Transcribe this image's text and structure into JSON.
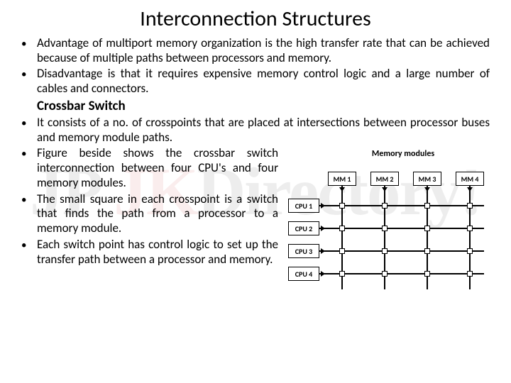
{
  "title": "Interconnection Structures",
  "bullets": {
    "b1": "Advantage of multiport memory organization is the high transfer rate that can be achieved because of multiple paths between processors and memory.",
    "b2": "Disadvantage is that it requires expensive memory control logic and a large number of cables and connectors.",
    "sub": "Crossbar Switch",
    "b3": "It consists of a no. of crosspoints that are placed at intersections between processor buses and memory module paths.",
    "b4": "Figure beside shows the crossbar switch interconnection between four CPU's and four memory modules.",
    "b5": "The small square in each crosspoint is a switch that finds the path from a processor to a memory module.",
    "b6": "Each switch point has control logic to set up the transfer path between a processor and memory."
  },
  "diagram": {
    "caption": "Memory modules",
    "mm": [
      "MM 1",
      "MM 2",
      "MM 3",
      "MM 4"
    ],
    "cpu": [
      "CPU 1",
      "CPU 2",
      "CPU 3",
      "CPU 4"
    ]
  },
  "watermark": {
    "prefix": "JP ",
    "main": "JK",
    "suffix": "Directory!"
  },
  "chart_data": {
    "type": "table",
    "title": "Crossbar switch interconnection (4 CPUs × 4 memory modules)",
    "columns": [
      "MM 1",
      "MM 2",
      "MM 3",
      "MM 4"
    ],
    "rows": [
      "CPU 1",
      "CPU 2",
      "CPU 3",
      "CPU 4"
    ],
    "cells": [
      [
        "crosspoint",
        "crosspoint",
        "crosspoint",
        "crosspoint"
      ],
      [
        "crosspoint",
        "crosspoint",
        "crosspoint",
        "crosspoint"
      ],
      [
        "crosspoint",
        "crosspoint",
        "crosspoint",
        "crosspoint"
      ],
      [
        "crosspoint",
        "crosspoint",
        "crosspoint",
        "crosspoint"
      ]
    ]
  }
}
